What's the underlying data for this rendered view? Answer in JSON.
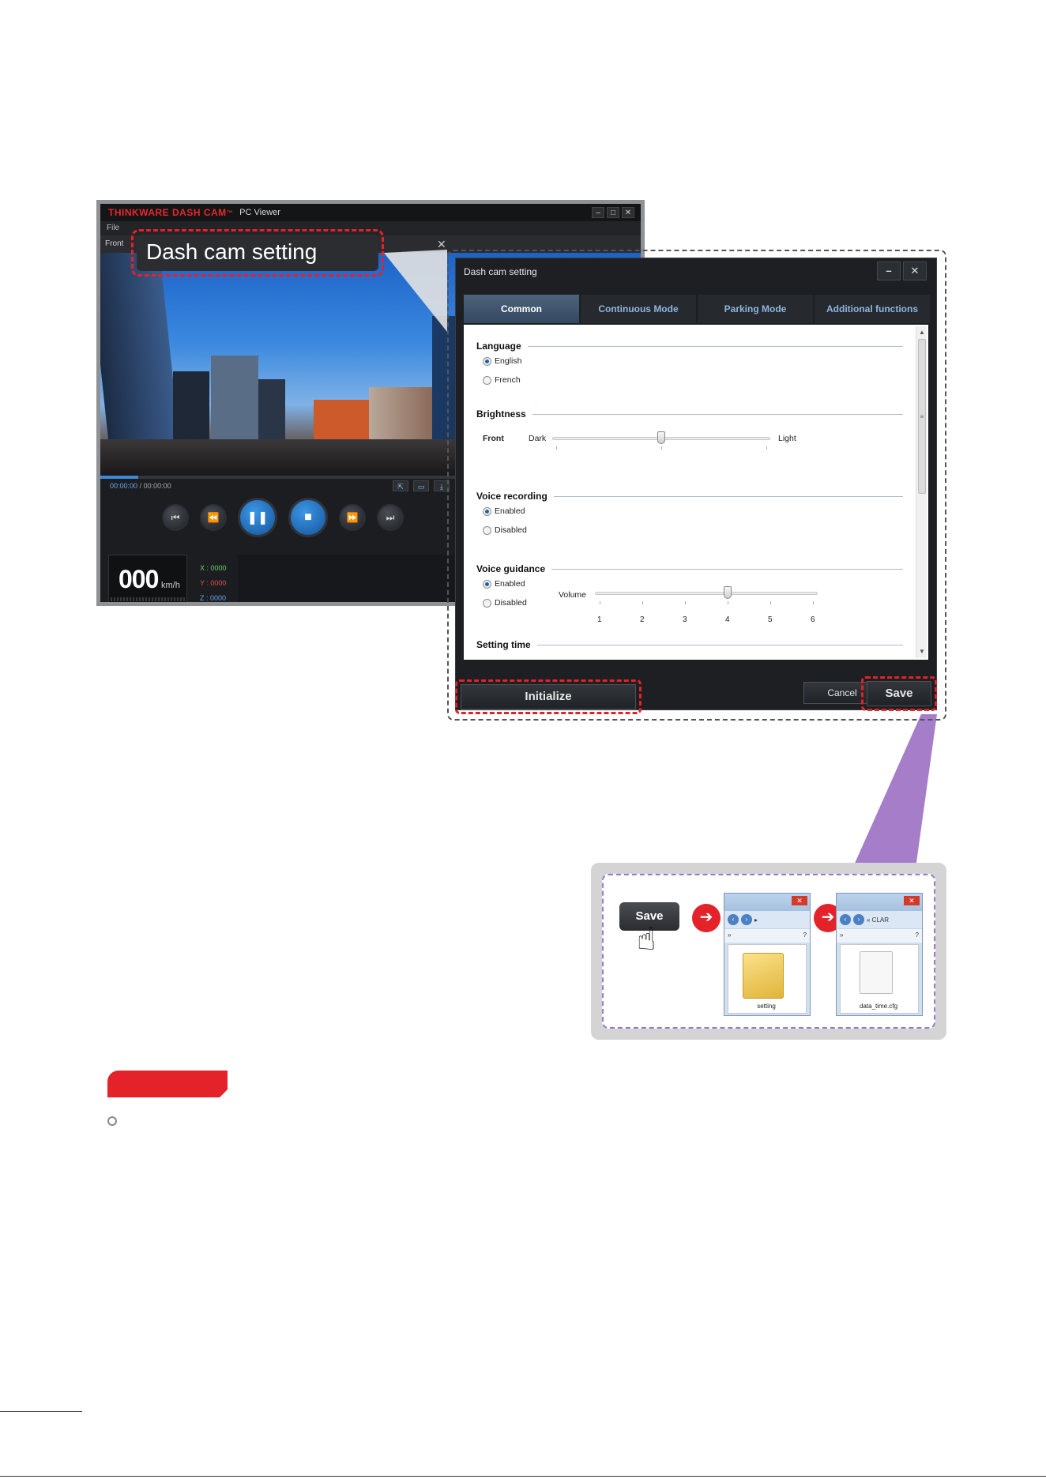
{
  "viewer": {
    "brand": "THINKWARE DASH CAM",
    "brand_sup": "™",
    "subtitle": "PC Viewer",
    "menu_file": "File",
    "tab_front": "Front",
    "time_current": "00:00:00",
    "time_total": "/ 00:00:00",
    "speed_value": "000",
    "speed_unit": "km/h",
    "axis_x": "X : 0000",
    "axis_y": "Y : 0000",
    "axis_z": "Z : 0000",
    "progress_fraction": 0.07
  },
  "callout": {
    "label": "Dash cam setting"
  },
  "dialog": {
    "title": "Dash cam setting",
    "tabs": [
      {
        "label": "Common"
      },
      {
        "label": "Continuous Mode"
      },
      {
        "label": "Parking Mode"
      },
      {
        "label": "Additional functions"
      }
    ],
    "language": {
      "heading": "Language",
      "options": [
        "English",
        "French"
      ],
      "selected": "English"
    },
    "brightness": {
      "heading": "Brightness",
      "row_label": "Front",
      "min_label": "Dark",
      "max_label": "Light",
      "level_fraction": 0.5
    },
    "voice_recording": {
      "heading": "Voice recording",
      "options": [
        "Enabled",
        "Disabled"
      ],
      "selected": "Enabled"
    },
    "voice_guidance": {
      "heading": "Voice guidance",
      "options": [
        "Enabled",
        "Disabled"
      ],
      "selected": "Enabled",
      "volume_label": "Volume",
      "volume_scale": [
        "1",
        "2",
        "3",
        "4",
        "5",
        "6"
      ],
      "volume_value": 4
    },
    "setting_time": {
      "heading": "Setting time"
    },
    "buttons": {
      "initialize": "Initialize",
      "cancel": "Cancel",
      "save": "Save"
    }
  },
  "save_flow": {
    "save_label": "Save",
    "step1_folder_label": "setting",
    "step2_file_label": "data_time.cfg",
    "step2_path": "« CLAR",
    "accent": "#e3222a",
    "frame_color": "#9b79c6"
  }
}
